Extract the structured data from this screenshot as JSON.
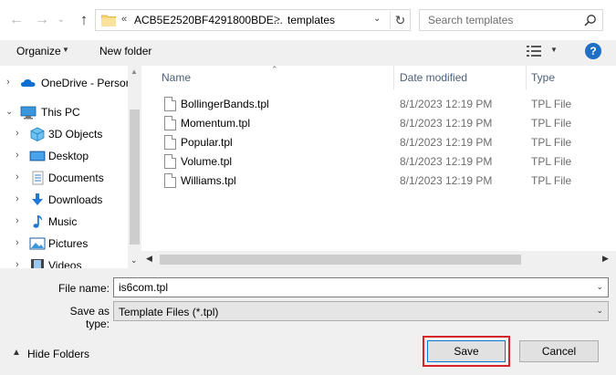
{
  "address_bar": {
    "overflow_marker": "«",
    "crumbs": [
      "ACB5E2520BF4291800BDE...",
      "templates"
    ],
    "separator": ">"
  },
  "search": {
    "placeholder": "Search templates"
  },
  "toolbar": {
    "organize_label": "Organize",
    "new_folder_label": "New folder"
  },
  "help": {
    "label": "?"
  },
  "nav_pane": {
    "items": [
      {
        "label": "OneDrive - Persor",
        "icon": "cloud-icon"
      },
      {
        "label": "This PC",
        "icon": "computer-icon"
      },
      {
        "label": "3D Objects",
        "icon": "cube-icon"
      },
      {
        "label": "Desktop",
        "icon": "desktop-icon"
      },
      {
        "label": "Documents",
        "icon": "documents-icon"
      },
      {
        "label": "Downloads",
        "icon": "download-arrow-icon"
      },
      {
        "label": "Music",
        "icon": "music-note-icon"
      },
      {
        "label": "Pictures",
        "icon": "pictures-icon"
      },
      {
        "label": "Videos",
        "icon": "film-icon"
      }
    ]
  },
  "file_list": {
    "columns": {
      "name": "Name",
      "date": "Date modified",
      "type": "Type"
    },
    "files": [
      {
        "name": "BollingerBands.tpl",
        "date": "8/1/2023 12:19 PM",
        "type": "TPL File"
      },
      {
        "name": "Momentum.tpl",
        "date": "8/1/2023 12:19 PM",
        "type": "TPL File"
      },
      {
        "name": "Popular.tpl",
        "date": "8/1/2023 12:19 PM",
        "type": "TPL File"
      },
      {
        "name": "Volume.tpl",
        "date": "8/1/2023 12:19 PM",
        "type": "TPL File"
      },
      {
        "name": "Williams.tpl",
        "date": "8/1/2023 12:19 PM",
        "type": "TPL File"
      }
    ]
  },
  "form": {
    "file_name_label": "File name:",
    "file_name_value": "is6com.tpl",
    "save_type_label": "Save as type:",
    "save_type_value": "Template Files (*.tpl)"
  },
  "footer": {
    "hide_folders_label": "Hide Folders",
    "save_label": "Save",
    "cancel_label": "Cancel"
  },
  "colors": {
    "accent": "#0078d7",
    "highlight_box": "#d6242b",
    "folder": "#f8d775",
    "help": "#1f6fc5"
  }
}
